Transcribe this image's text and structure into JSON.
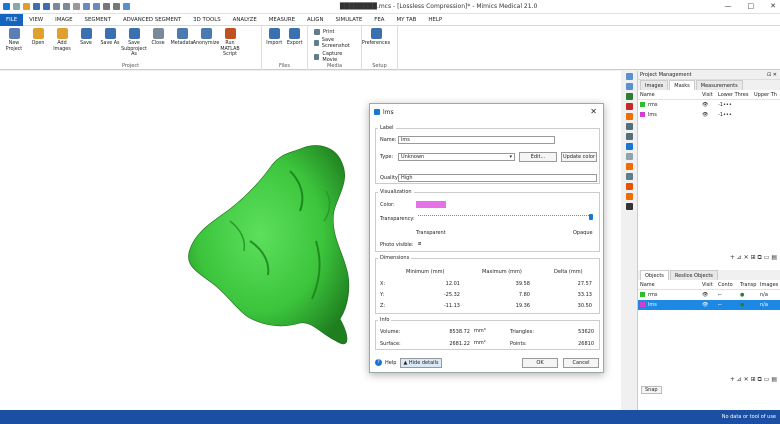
{
  "window": {
    "title": "████████.mcs - [Lossless Compression]* - Mimics Medical 21.0",
    "controls": [
      "—",
      "□",
      "✕"
    ]
  },
  "menu": {
    "tabs": [
      "FILE",
      "VIEW",
      "IMAGE",
      "SEGMENT",
      "ADVANCED SEGMENT",
      "3D TOOLS",
      "ANALYZE",
      "MEASURE",
      "ALIGN",
      "SIMULATE",
      "FEA",
      "MY TAB",
      "HELP"
    ]
  },
  "ribbon": {
    "project_buttons": [
      {
        "label": "New Project",
        "icon": "new-project-icon",
        "color": "#5a7fb5"
      },
      {
        "label": "Open",
        "icon": "open-folder-icon",
        "color": "#e0a030"
      },
      {
        "label": "Add Images",
        "icon": "add-images-icon",
        "color": "#e0a030"
      },
      {
        "label": "Save",
        "icon": "save-icon",
        "color": "#3a6fb0"
      },
      {
        "label": "Save As",
        "icon": "save-as-icon",
        "color": "#3a6fb0"
      },
      {
        "label": "Save Subproject As",
        "icon": "save-subproject-icon",
        "color": "#3a6fb0"
      },
      {
        "label": "Close",
        "icon": "close-project-icon",
        "color": "#7a8a9a"
      },
      {
        "label": "Metadata",
        "icon": "metadata-icon",
        "color": "#4a7ab0"
      },
      {
        "label": "Anonymize",
        "icon": "anonymize-icon",
        "color": "#4a7ab0"
      },
      {
        "label": "Run MATLAB Script",
        "icon": "matlab-icon",
        "color": "#c05020"
      }
    ],
    "project_label": "Project",
    "files_buttons": [
      {
        "label": "Import",
        "icon": "import-icon",
        "color": "#3a6fb0"
      },
      {
        "label": "Export",
        "icon": "export-icon",
        "color": "#3a6fb0"
      }
    ],
    "files_label": "Files",
    "media_items": [
      "Print",
      "Save Screenshot",
      "Capture Movie"
    ],
    "media_label": "Media",
    "setup_buttons": [
      {
        "label": "Preferences",
        "icon": "gear-icon",
        "color": "#3a6fb0"
      }
    ],
    "setup_label": "Setup"
  },
  "project_management": {
    "title": "Project Management",
    "tabs": [
      "Images",
      "Masks",
      "Measurements"
    ],
    "masks_columns": [
      "Name",
      "Visit",
      "Lower Thres",
      "Upper Th"
    ],
    "masks": [
      {
        "name": "rms",
        "color": "#2bbf2b",
        "visible": "👁",
        "lower": "-1•••",
        "upper": ""
      },
      {
        "name": "lms",
        "color": "#d040d0",
        "visible": "👁",
        "lower": "-1•••",
        "upper": ""
      }
    ],
    "masks_tools": "+ ⊿ ✕ ⊞ ⧉ ▭ ▤",
    "objects_tabs": [
      "Objects",
      "Reslice Objects"
    ],
    "objects_columns": [
      "Name",
      "Visit",
      "Conto",
      "Transp",
      "Images"
    ],
    "objects": [
      {
        "name": "rms",
        "color": "#2bbf2b",
        "visible": "👁",
        "contour": "⌐",
        "transp": "●",
        "images": "n/a"
      },
      {
        "name": "lms",
        "color": "#d040d0",
        "visible": "👁",
        "contour": "⌐",
        "transp": "●",
        "images": "n/a"
      }
    ],
    "objects_tools": "+ ⊿ ✕ ⊞ ⧉ ▭ ▤",
    "snap_label": "Snap"
  },
  "statusbar": {
    "text": "No data or tool of use"
  },
  "dialog": {
    "title": "lms",
    "label_section": "Label",
    "name_label": "Name:",
    "name_value": "lms",
    "type_label": "Type:",
    "type_value": "Unknown",
    "edit_label": "Edit...",
    "update_color_label": "Update color",
    "quality_label": "Quality:",
    "quality_value": "High",
    "visualization_section": "Visualization",
    "color_label": "Color:",
    "color_value": "#e670e6",
    "transparency_label": "Transparency:",
    "transparent_label": "Transparent",
    "opaque_label": "Opaque",
    "transparency_level": 1.0,
    "photo_visible_label": "Photo visible:",
    "dimensions_section": "Dimensions",
    "dim_headers": [
      "Minimum (mm)",
      "Maximum (mm)",
      "Delta (mm)"
    ],
    "dims": [
      {
        "axis": "X:",
        "min": "12.01",
        "max": "39.58",
        "delta": "27.57"
      },
      {
        "axis": "Y:",
        "min": "-25.32",
        "max": "7.80",
        "delta": "33.13"
      },
      {
        "axis": "Z:",
        "min": "-11.13",
        "max": "19.36",
        "delta": "30.50"
      }
    ],
    "info_section": "Info",
    "volume_label": "Volume:",
    "volume_value": "8538.72",
    "volume_unit": "mm³",
    "surface_label": "Surface:",
    "surface_value": "2681.22",
    "surface_unit": "mm²",
    "triangles_label": "Triangles:",
    "triangles_value": "53620",
    "points_label": "Points:",
    "points_value": "26810",
    "help_label": "Help",
    "hide_details_label": "Hide details",
    "ok_label": "OK",
    "cancel_label": "Cancel"
  },
  "model": {
    "color": "#3cc43c"
  }
}
